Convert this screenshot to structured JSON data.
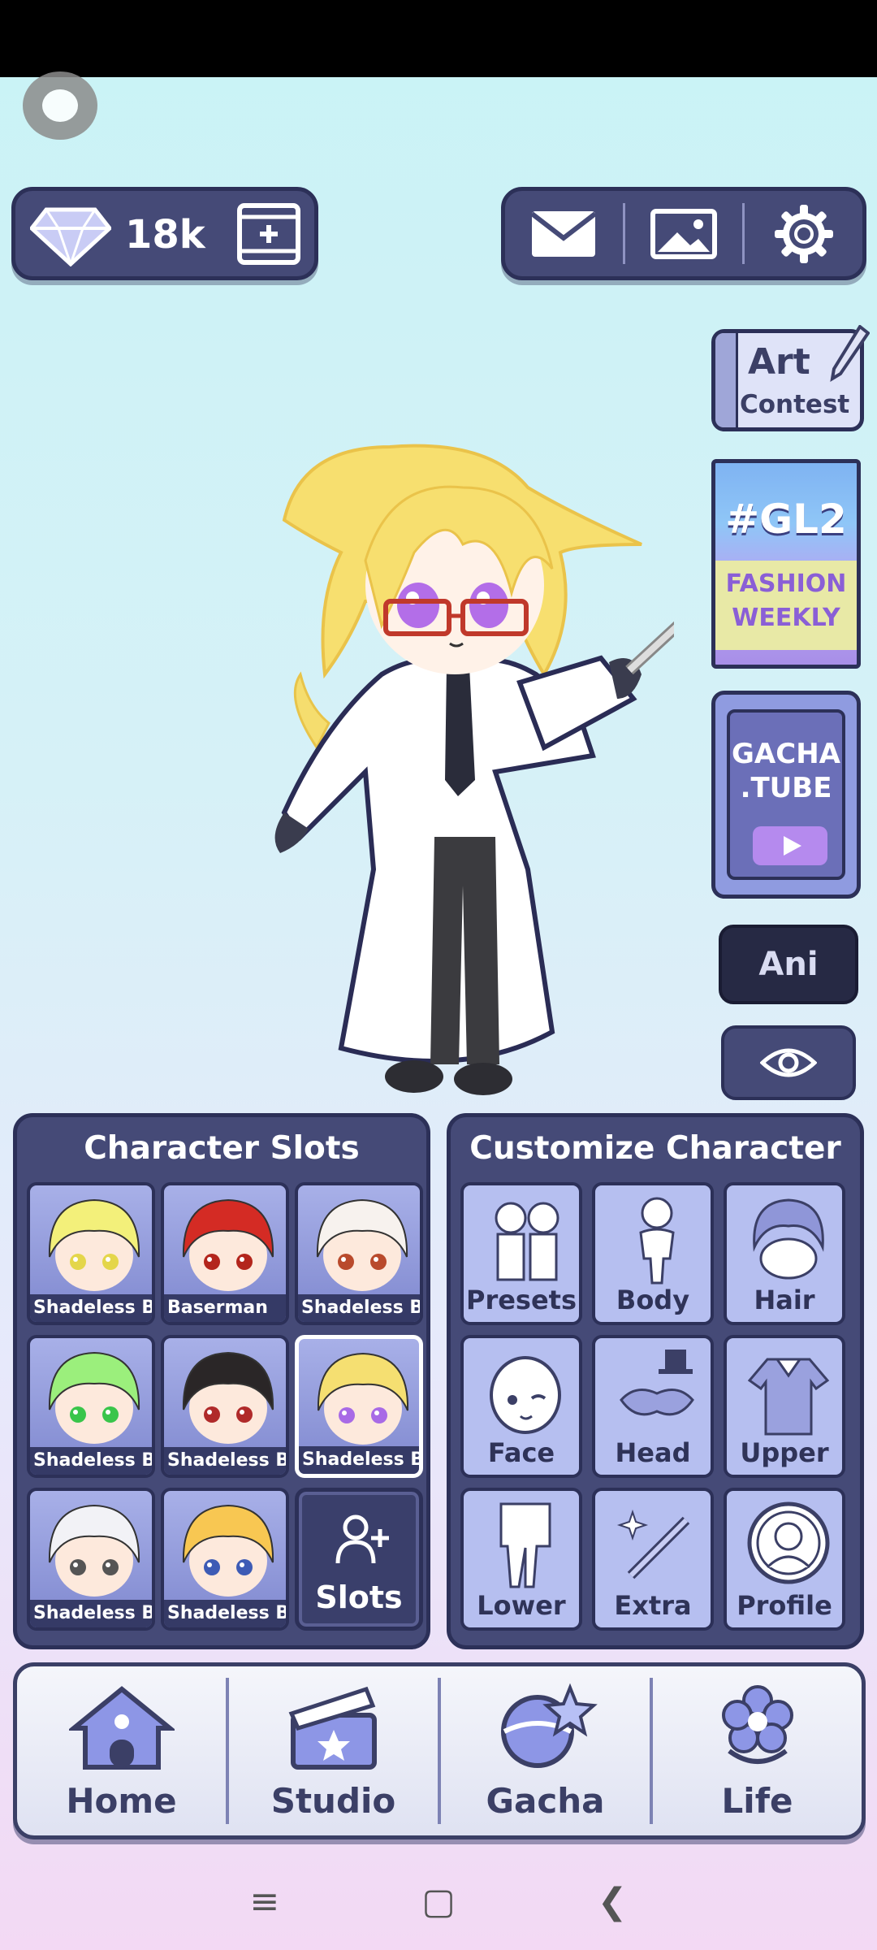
{
  "currency": {
    "gems": "18k"
  },
  "side": {
    "art_line1": "Art",
    "art_line2": "Contest",
    "gl2_title": "#GL2",
    "gl2_line1": "FASHION",
    "gl2_line2": "WEEKLY",
    "tube_line1": "GACHA",
    "tube_line2": ".TUBE",
    "ani_label": "Ani"
  },
  "slots": {
    "title": "Character Slots",
    "items": [
      {
        "label": "Shadeless Bas",
        "hair": "#f3f07a",
        "eyes": "#e4d64a"
      },
      {
        "label": "Baserman",
        "hair": "#d42b24",
        "eyes": "#b3251c"
      },
      {
        "label": "Shadeless Bas",
        "hair": "#f7f2ee",
        "eyes": "#b94a2c"
      },
      {
        "label": "Shadeless Bas",
        "hair": "#9bef7c",
        "eyes": "#39c54a"
      },
      {
        "label": "Shadeless Bas",
        "hair": "#2a2627",
        "eyes": "#b02a2a"
      },
      {
        "label": "Shadeless Bas",
        "hair": "#f5df71",
        "eyes": "#a86ae6"
      },
      {
        "label": "Shadeless Bas",
        "hair": "#f2f2f6",
        "eyes": "#555555"
      },
      {
        "label": "Shadeless Bas",
        "hair": "#f8c752",
        "eyes": "#3d5bb5"
      }
    ],
    "add_label": "Slots"
  },
  "customize": {
    "title": "Customize Character",
    "items": [
      {
        "label": "Presets"
      },
      {
        "label": "Body"
      },
      {
        "label": "Hair"
      },
      {
        "label": "Face"
      },
      {
        "label": "Head"
      },
      {
        "label": "Upper"
      },
      {
        "label": "Lower"
      },
      {
        "label": "Extra"
      },
      {
        "label": "Profile"
      }
    ]
  },
  "nav": {
    "items": [
      {
        "label": "Home"
      },
      {
        "label": "Studio"
      },
      {
        "label": "Gacha"
      },
      {
        "label": "Life"
      }
    ]
  },
  "colors": {
    "panel": "#454a77",
    "panel_border": "#2c3058",
    "tile": "#b6bff0"
  }
}
